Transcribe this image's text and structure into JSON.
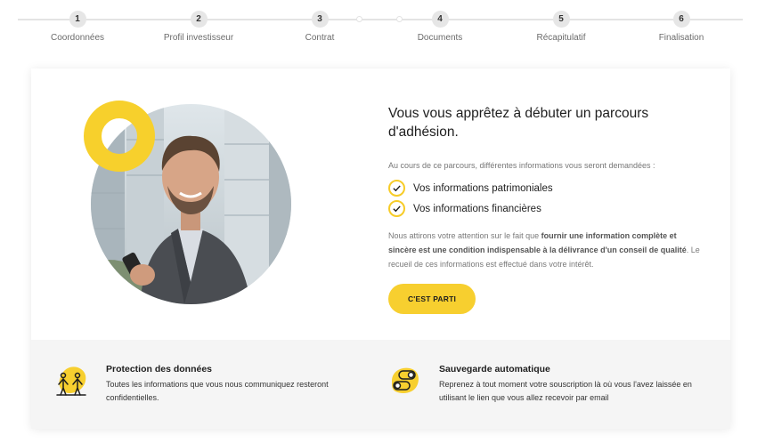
{
  "stepper": {
    "steps": [
      {
        "number": "1",
        "label": "Coordonnées"
      },
      {
        "number": "2",
        "label": "Profil investisseur"
      },
      {
        "number": "3",
        "label": "Contrat"
      },
      {
        "number": "4",
        "label": "Documents"
      },
      {
        "number": "5",
        "label": "Récapitulatif"
      },
      {
        "number": "6",
        "label": "Finalisation"
      }
    ]
  },
  "hero": {
    "headline": "Vous vous apprêtez à débuter un parcours d'adhésion.",
    "intro": "Au cours de ce parcours, différentes informations vous seront demandées :",
    "checklist": [
      "Vos informations patrimoniales",
      "Vos informations financières"
    ],
    "notice_before": "Nous attirons votre attention sur le fait que ",
    "notice_bold": "fournir une information complète et sincère est une condition indispensable à la délivrance d'un conseil de qualité",
    "notice_after": ". Le recueil de ces informations est effectué dans votre intérêt.",
    "cta_label": "C'EST PARTI"
  },
  "features": {
    "protection": {
      "title": "Protection des données",
      "description": "Toutes les informations que vous nous communiquez resteront confidentielles."
    },
    "autosave": {
      "title": "Sauvegarde automatique",
      "description": "Reprenez à tout moment votre souscription là où vous l'avez laissée en utilisant le lien que vous allez recevoir par email"
    }
  },
  "colors": {
    "accent": "#f7cf2f",
    "step_circle": "#e6e6e6",
    "band_background": "#f5f5f5"
  },
  "icons": {
    "check": "check-icon",
    "protection": "people-shield-icon",
    "autosave": "sync-toggle-icon"
  }
}
